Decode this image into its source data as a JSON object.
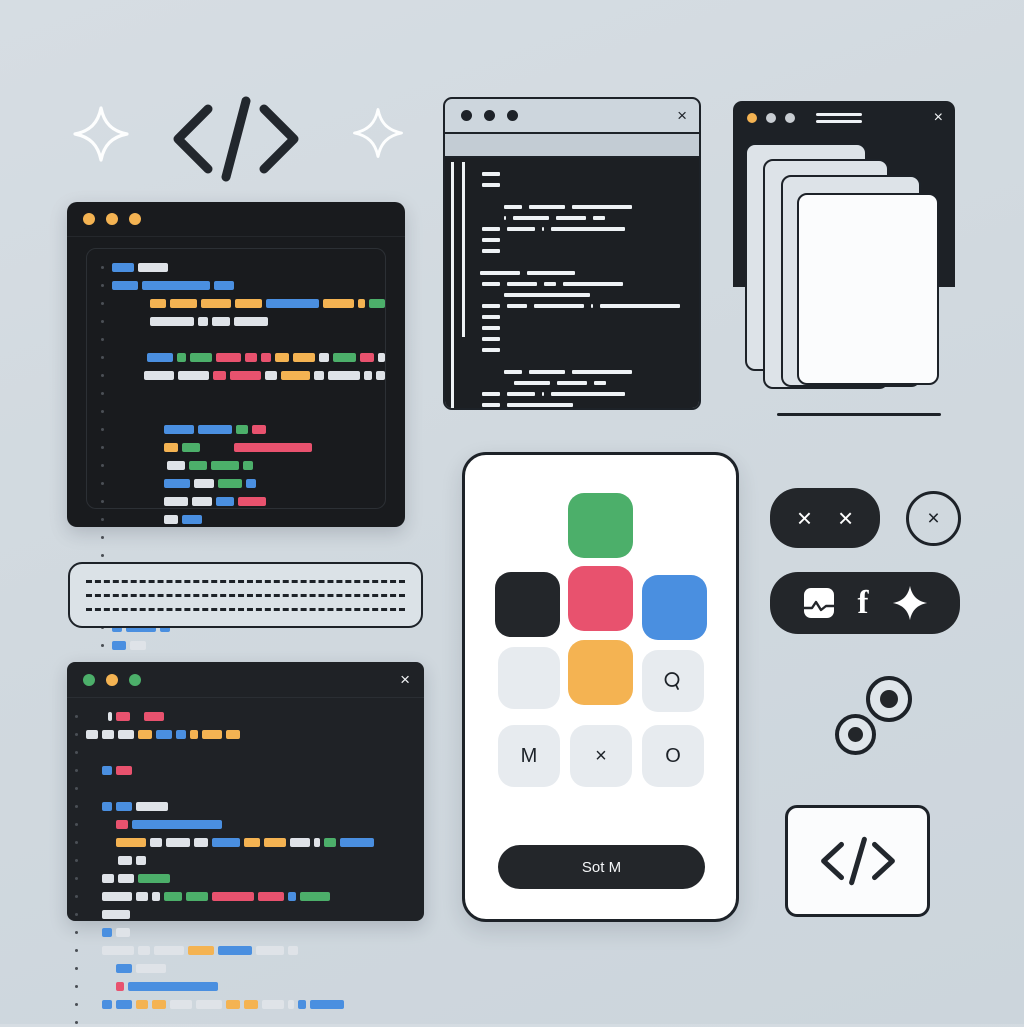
{
  "background": {
    "color": "#d2dae0"
  },
  "palette": {
    "dark": "#1d2228",
    "panel": "#191b1e",
    "blue": "#4a8fe0",
    "green": "#4caf6a",
    "pink": "#e8526e",
    "amber": "#f4b352",
    "light": "#dfe3e8",
    "white": "#f2f4f6"
  },
  "header_decor": {
    "left_sparkle": "sparkle-icon",
    "code_symbol": "</>",
    "right_sparkle": "sparkle-icon"
  },
  "main_editor": {
    "name": "code-editor-window",
    "traffic_lights": [
      "#f4b352",
      "#f4b352",
      "#f4b352"
    ],
    "code_lines": [
      {
        "indent": 0,
        "bars": [
          [
            22,
            "blue"
          ],
          [
            30,
            "light"
          ]
        ]
      },
      {
        "indent": 0,
        "bars": [
          [
            26,
            "blue"
          ],
          [
            68,
            "blue"
          ],
          [
            20,
            "blue"
          ]
        ]
      },
      {
        "indent": 38,
        "bars": [
          [
            18,
            "amber"
          ],
          [
            30,
            "amber"
          ],
          [
            34,
            "amber"
          ],
          [
            30,
            "amber"
          ],
          [
            60,
            "blue"
          ],
          [
            34,
            "amber"
          ],
          [
            8,
            "amber"
          ],
          [
            18,
            "green"
          ]
        ]
      },
      {
        "indent": 38,
        "bars": [
          [
            44,
            "light"
          ],
          [
            10,
            "light"
          ],
          [
            18,
            "light"
          ],
          [
            34,
            "light"
          ]
        ]
      },
      {
        "indent": 0,
        "bars": []
      },
      {
        "indent": 35,
        "bars": [
          [
            36,
            "blue"
          ],
          [
            12,
            "green"
          ],
          [
            30,
            "green"
          ],
          [
            34,
            "pink"
          ],
          [
            16,
            "pink"
          ],
          [
            14,
            "pink"
          ],
          [
            18,
            "amber"
          ],
          [
            30,
            "amber"
          ],
          [
            14,
            "light"
          ],
          [
            32,
            "green"
          ],
          [
            18,
            "pink"
          ],
          [
            10,
            "light"
          ]
        ]
      },
      {
        "indent": 32,
        "bars": [
          [
            38,
            "light"
          ],
          [
            40,
            "light"
          ],
          [
            16,
            "pink"
          ],
          [
            40,
            "pink"
          ],
          [
            16,
            "light"
          ],
          [
            36,
            "amber"
          ],
          [
            14,
            "light"
          ],
          [
            40,
            "light"
          ],
          [
            10,
            "light"
          ],
          [
            12,
            "light"
          ]
        ]
      },
      {
        "indent": 0,
        "bars": []
      },
      {
        "indent": 0,
        "bars": []
      },
      {
        "indent": 52,
        "bars": [
          [
            30,
            "blue"
          ],
          [
            34,
            "blue"
          ],
          [
            12,
            "green"
          ],
          [
            14,
            "pink"
          ]
        ]
      },
      {
        "indent": 52,
        "bars": [
          [
            14,
            "amber"
          ],
          [
            18,
            "green"
          ],
          [
            0,
            "gap"
          ],
          [
            78,
            "pink"
          ]
        ]
      },
      {
        "indent": 55,
        "bars": [
          [
            18,
            "light"
          ],
          [
            18,
            "green"
          ],
          [
            28,
            "green"
          ],
          [
            10,
            "green"
          ]
        ]
      },
      {
        "indent": 52,
        "bars": [
          [
            26,
            "blue"
          ],
          [
            20,
            "light"
          ],
          [
            24,
            "green"
          ],
          [
            10,
            "blue"
          ]
        ]
      },
      {
        "indent": 52,
        "bars": [
          [
            24,
            "light"
          ],
          [
            20,
            "light"
          ],
          [
            18,
            "blue"
          ],
          [
            28,
            "pink"
          ]
        ]
      },
      {
        "indent": 52,
        "bars": [
          [
            14,
            "light"
          ],
          [
            20,
            "blue"
          ]
        ]
      },
      {
        "indent": 0,
        "bars": []
      },
      {
        "indent": 0,
        "bars": []
      },
      {
        "indent": 36,
        "bars": [
          [
            38,
            "light"
          ],
          [
            40,
            "blue"
          ],
          [
            14,
            "green"
          ],
          [
            12,
            "green"
          ],
          [
            32,
            "green"
          ],
          [
            12,
            "pink"
          ],
          [
            10,
            "light"
          ]
        ]
      },
      {
        "indent": 36,
        "bars": [
          [
            30,
            "amber"
          ],
          [
            30,
            "amber"
          ],
          [
            10,
            "blue"
          ],
          [
            28,
            "green"
          ],
          [
            38,
            "amber"
          ],
          [
            8,
            "green"
          ],
          [
            34,
            "amber"
          ],
          [
            10,
            "amber"
          ],
          [
            14,
            "amber"
          ]
        ]
      },
      {
        "indent": 36,
        "bars": [
          [
            24,
            "blue"
          ],
          [
            14,
            "blue"
          ],
          [
            26,
            "blue"
          ]
        ]
      },
      {
        "indent": 0,
        "bars": [
          [
            10,
            "blue"
          ],
          [
            30,
            "blue"
          ],
          [
            10,
            "blue"
          ]
        ]
      },
      {
        "indent": 0,
        "bars": [
          [
            14,
            "blue"
          ],
          [
            16,
            "light"
          ]
        ]
      }
    ]
  },
  "dashed_card": {
    "name": "placeholder-text-card",
    "line_count": 3
  },
  "bottom_editor": {
    "name": "secondary-code-window",
    "traffic_lights": [
      "#4caf6a",
      "#f4b352",
      "#4caf6a"
    ],
    "close_label": "×",
    "code_lines": [
      {
        "indent": 22,
        "bars": [
          [
            4,
            "light"
          ],
          [
            14,
            "pink"
          ],
          [
            0,
            "gap6"
          ],
          [
            20,
            "pink"
          ]
        ]
      },
      {
        "indent": 0,
        "bars": [
          [
            12,
            "light"
          ],
          [
            12,
            "light"
          ],
          [
            16,
            "light"
          ],
          [
            14,
            "amber"
          ],
          [
            16,
            "blue"
          ],
          [
            10,
            "blue"
          ],
          [
            8,
            "amber"
          ],
          [
            20,
            "amber"
          ],
          [
            14,
            "amber"
          ]
        ]
      },
      {
        "indent": 0,
        "bars": []
      },
      {
        "indent": 16,
        "bars": [
          [
            10,
            "blue"
          ],
          [
            16,
            "pink"
          ]
        ]
      },
      {
        "indent": 0,
        "bars": []
      },
      {
        "indent": 16,
        "bars": [
          [
            10,
            "blue"
          ],
          [
            16,
            "blue"
          ],
          [
            32,
            "light"
          ]
        ]
      },
      {
        "indent": 30,
        "bars": [
          [
            12,
            "pink"
          ],
          [
            90,
            "blue"
          ]
        ]
      },
      {
        "indent": 30,
        "bars": [
          [
            30,
            "amber"
          ],
          [
            12,
            "light"
          ],
          [
            24,
            "light"
          ],
          [
            14,
            "light"
          ],
          [
            28,
            "blue"
          ],
          [
            16,
            "amber"
          ],
          [
            22,
            "amber"
          ],
          [
            20,
            "light"
          ],
          [
            6,
            "light"
          ],
          [
            12,
            "green"
          ],
          [
            34,
            "blue"
          ]
        ]
      },
      {
        "indent": 32,
        "bars": [
          [
            14,
            "light"
          ],
          [
            10,
            "light"
          ]
        ]
      },
      {
        "indent": 16,
        "bars": [
          [
            12,
            "light"
          ],
          [
            16,
            "light"
          ],
          [
            32,
            "green"
          ]
        ]
      },
      {
        "indent": 16,
        "bars": [
          [
            30,
            "light"
          ],
          [
            12,
            "light"
          ],
          [
            8,
            "light"
          ],
          [
            18,
            "green"
          ],
          [
            22,
            "green"
          ],
          [
            42,
            "pink"
          ],
          [
            26,
            "pink"
          ],
          [
            8,
            "blue"
          ],
          [
            30,
            "green"
          ]
        ]
      },
      {
        "indent": 16,
        "bars": [
          [
            28,
            "light"
          ]
        ]
      },
      {
        "indent": 16,
        "bars": [
          [
            10,
            "blue"
          ],
          [
            14,
            "light"
          ]
        ]
      },
      {
        "indent": 16,
        "bars": [
          [
            32,
            "light"
          ],
          [
            12,
            "light"
          ],
          [
            30,
            "light"
          ],
          [
            26,
            "amber"
          ],
          [
            34,
            "blue"
          ],
          [
            28,
            "light"
          ],
          [
            10,
            "light"
          ]
        ]
      },
      {
        "indent": 30,
        "bars": [
          [
            16,
            "blue"
          ],
          [
            30,
            "light"
          ]
        ]
      },
      {
        "indent": 30,
        "bars": [
          [
            8,
            "pink"
          ],
          [
            90,
            "blue"
          ]
        ]
      },
      {
        "indent": 16,
        "bars": [
          [
            10,
            "blue"
          ],
          [
            16,
            "blue"
          ],
          [
            12,
            "amber"
          ],
          [
            14,
            "amber"
          ],
          [
            22,
            "light"
          ],
          [
            26,
            "light"
          ],
          [
            14,
            "amber"
          ],
          [
            14,
            "amber"
          ],
          [
            22,
            "light"
          ],
          [
            6,
            "light"
          ],
          [
            8,
            "blue"
          ],
          [
            34,
            "blue"
          ]
        ]
      },
      {
        "indent": 0,
        "bars": []
      }
    ]
  },
  "mono_window": {
    "name": "terminal-window",
    "dots": 3,
    "close_label": "×",
    "code_lines": [
      {
        "indent": 30,
        "bars": [
          18
        ]
      },
      {
        "indent": 30,
        "bars": [
          18
        ]
      },
      {
        "indent": 0,
        "bars": []
      },
      {
        "indent": 52,
        "bars": [
          18,
          36,
          60
        ]
      },
      {
        "indent": 52,
        "bars": [
          2,
          36,
          30,
          12
        ]
      },
      {
        "indent": 30,
        "bars": [
          18,
          28,
          2,
          74
        ]
      },
      {
        "indent": 30,
        "bars": [
          18
        ]
      },
      {
        "indent": 30,
        "bars": [
          18
        ]
      },
      {
        "indent": 0,
        "bars": []
      },
      {
        "indent": 28,
        "bars": [
          40,
          48
        ]
      },
      {
        "indent": 30,
        "bars": [
          18,
          30,
          12,
          60
        ]
      },
      {
        "indent": 52,
        "bars": [
          86
        ]
      },
      {
        "indent": 30,
        "bars": [
          18,
          20,
          50,
          2,
          80
        ]
      },
      {
        "indent": 30,
        "bars": [
          18
        ]
      },
      {
        "indent": 30,
        "bars": [
          18
        ]
      },
      {
        "indent": 30,
        "bars": [
          18
        ]
      },
      {
        "indent": 30,
        "bars": [
          18
        ]
      },
      {
        "indent": 0,
        "bars": []
      },
      {
        "indent": 52,
        "bars": [
          18,
          36,
          60
        ]
      },
      {
        "indent": 62,
        "bars": [
          36,
          30,
          12
        ]
      },
      {
        "indent": 30,
        "bars": [
          18,
          28,
          2,
          74
        ]
      },
      {
        "indent": 30,
        "bars": [
          18,
          66
        ]
      },
      {
        "indent": 8,
        "bars": [
          18,
          30,
          30,
          52
        ]
      }
    ]
  },
  "stack_window": {
    "name": "stacked-windows",
    "traffic_lights": [
      "#f4b352",
      "#c8cdd2",
      "#c8cdd2"
    ],
    "address_bars": 2,
    "close_label": "×",
    "card_count": 4
  },
  "phone": {
    "name": "mobile-app-mockup",
    "tiles": [
      {
        "label": "",
        "color": "#4caf6a",
        "icon": ""
      },
      {
        "label": "",
        "color": "#23262a",
        "icon": ""
      },
      {
        "label": "",
        "color": "#e8526e",
        "icon": ""
      },
      {
        "label": "",
        "color": "#4a8fe0",
        "icon": ""
      },
      {
        "label": "",
        "color": "#e7ebef",
        "icon": ""
      },
      {
        "label": "",
        "color": "#f4b352",
        "icon": ""
      },
      {
        "label": "",
        "color": "#e7ebef",
        "icon": "search-icon"
      },
      {
        "label": "M",
        "color": "#e7ebef",
        "icon": "letter-m"
      },
      {
        "label": "×",
        "color": "#e7ebef",
        "icon": "close-icon"
      },
      {
        "label": "O",
        "color": "#e7ebef",
        "icon": "circle-icon"
      }
    ],
    "cta_label": "Sot M"
  },
  "widgets": {
    "close_pill": {
      "name": "dual-close-pill",
      "icons": [
        "×",
        "×"
      ]
    },
    "close_circle": {
      "name": "close-circle-button",
      "icon": "×"
    },
    "social_pill": {
      "name": "social-icons-pill",
      "icons": [
        "image-icon",
        "f",
        "sparkle-icon"
      ]
    },
    "dots": {
      "name": "concentric-dots",
      "count": 2
    },
    "code_card": {
      "name": "code-snippet-card",
      "symbol": "</>"
    }
  }
}
